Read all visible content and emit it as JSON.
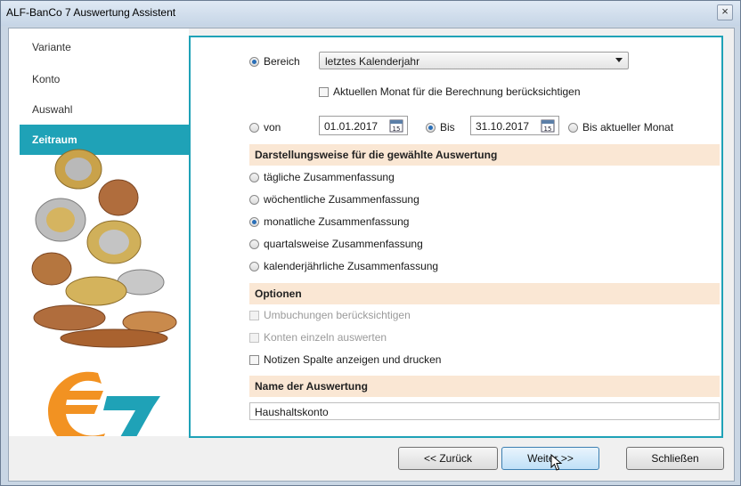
{
  "window": {
    "title": "ALF-BanCo 7 Auswertung Assistent",
    "close_symbol": "×"
  },
  "sidebar": {
    "items": [
      {
        "label": "Variante",
        "active": false
      },
      {
        "label": "Konto",
        "active": false
      },
      {
        "label": "Auswahl",
        "active": false
      },
      {
        "label": "Zeitraum",
        "active": true
      }
    ]
  },
  "range": {
    "bereich_label": "Bereich",
    "bereich_value": "letztes Kalenderjahr",
    "current_month_label": "Aktuellen Monat für die Berechnung berücksichtigen",
    "von_label": "von",
    "von_date": "01.01.2017",
    "bis_label": "Bis",
    "bis_date": "31.10.2017",
    "bis_current_label": "Bis aktueller Monat",
    "calendar_day": "15"
  },
  "display": {
    "heading": "Darstellungsweise für die gewählte Auswertung",
    "options": [
      {
        "label": "tägliche Zusammenfassung",
        "selected": false
      },
      {
        "label": "wöchentliche Zusammenfassung",
        "selected": false
      },
      {
        "label": "monatliche Zusammenfassung",
        "selected": true
      },
      {
        "label": "quartalsweise Zusammenfassung",
        "selected": false
      },
      {
        "label": "kalenderjährliche Zusammenfassung",
        "selected": false
      }
    ]
  },
  "options": {
    "heading": "Optionen",
    "items": [
      {
        "label": "Umbuchungen berücksichtigen",
        "enabled": false
      },
      {
        "label": "Konten einzeln auswerten",
        "enabled": false
      },
      {
        "label": "Notizen Spalte anzeigen und drucken",
        "enabled": true
      }
    ]
  },
  "name": {
    "heading": "Name der Auswertung",
    "value": "Haushaltskonto"
  },
  "footer": {
    "back_label": "<< Zurück",
    "next_label": "Weiter >>",
    "close_label": "Schließen"
  },
  "colors": {
    "accent": "#1fa2b7",
    "section_bg": "#fae7d4",
    "logo_orange": "#f29222"
  }
}
